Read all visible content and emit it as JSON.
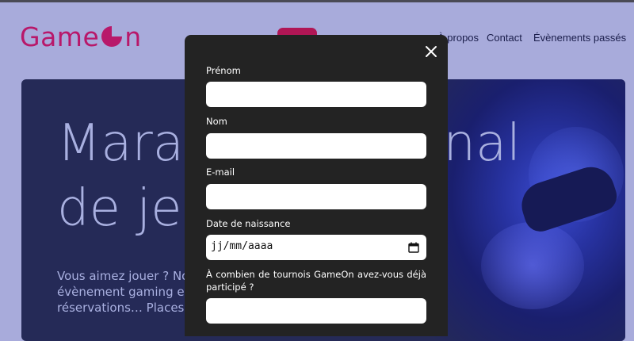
{
  "header": {
    "logo_before": "Game",
    "logo_after": "n",
    "nav": [
      "À propos",
      "Contact",
      "Évènements passés"
    ],
    "accent": "#b8186a"
  },
  "hero": {
    "title_lines": [
      "Marathon national",
      "de jeux vidéos"
    ],
    "text_lines": [
      "Vous aimez jouer ? Notre prochain",
      "évènement gaming est ouvert aux",
      "réservations… Places limitées !"
    ]
  },
  "modal": {
    "close_icon": "close-icon",
    "fields": [
      {
        "label": "Prénom",
        "value": ""
      },
      {
        "label": "Nom",
        "value": ""
      },
      {
        "label": "E-mail",
        "value": ""
      }
    ],
    "birthdate": {
      "label": "Date de naissance",
      "placeholder": "jj/mm/aaaa"
    },
    "tournaments": {
      "label": "À combien de tournois GameOn avez-vous déjà participé ?",
      "value": ""
    }
  }
}
